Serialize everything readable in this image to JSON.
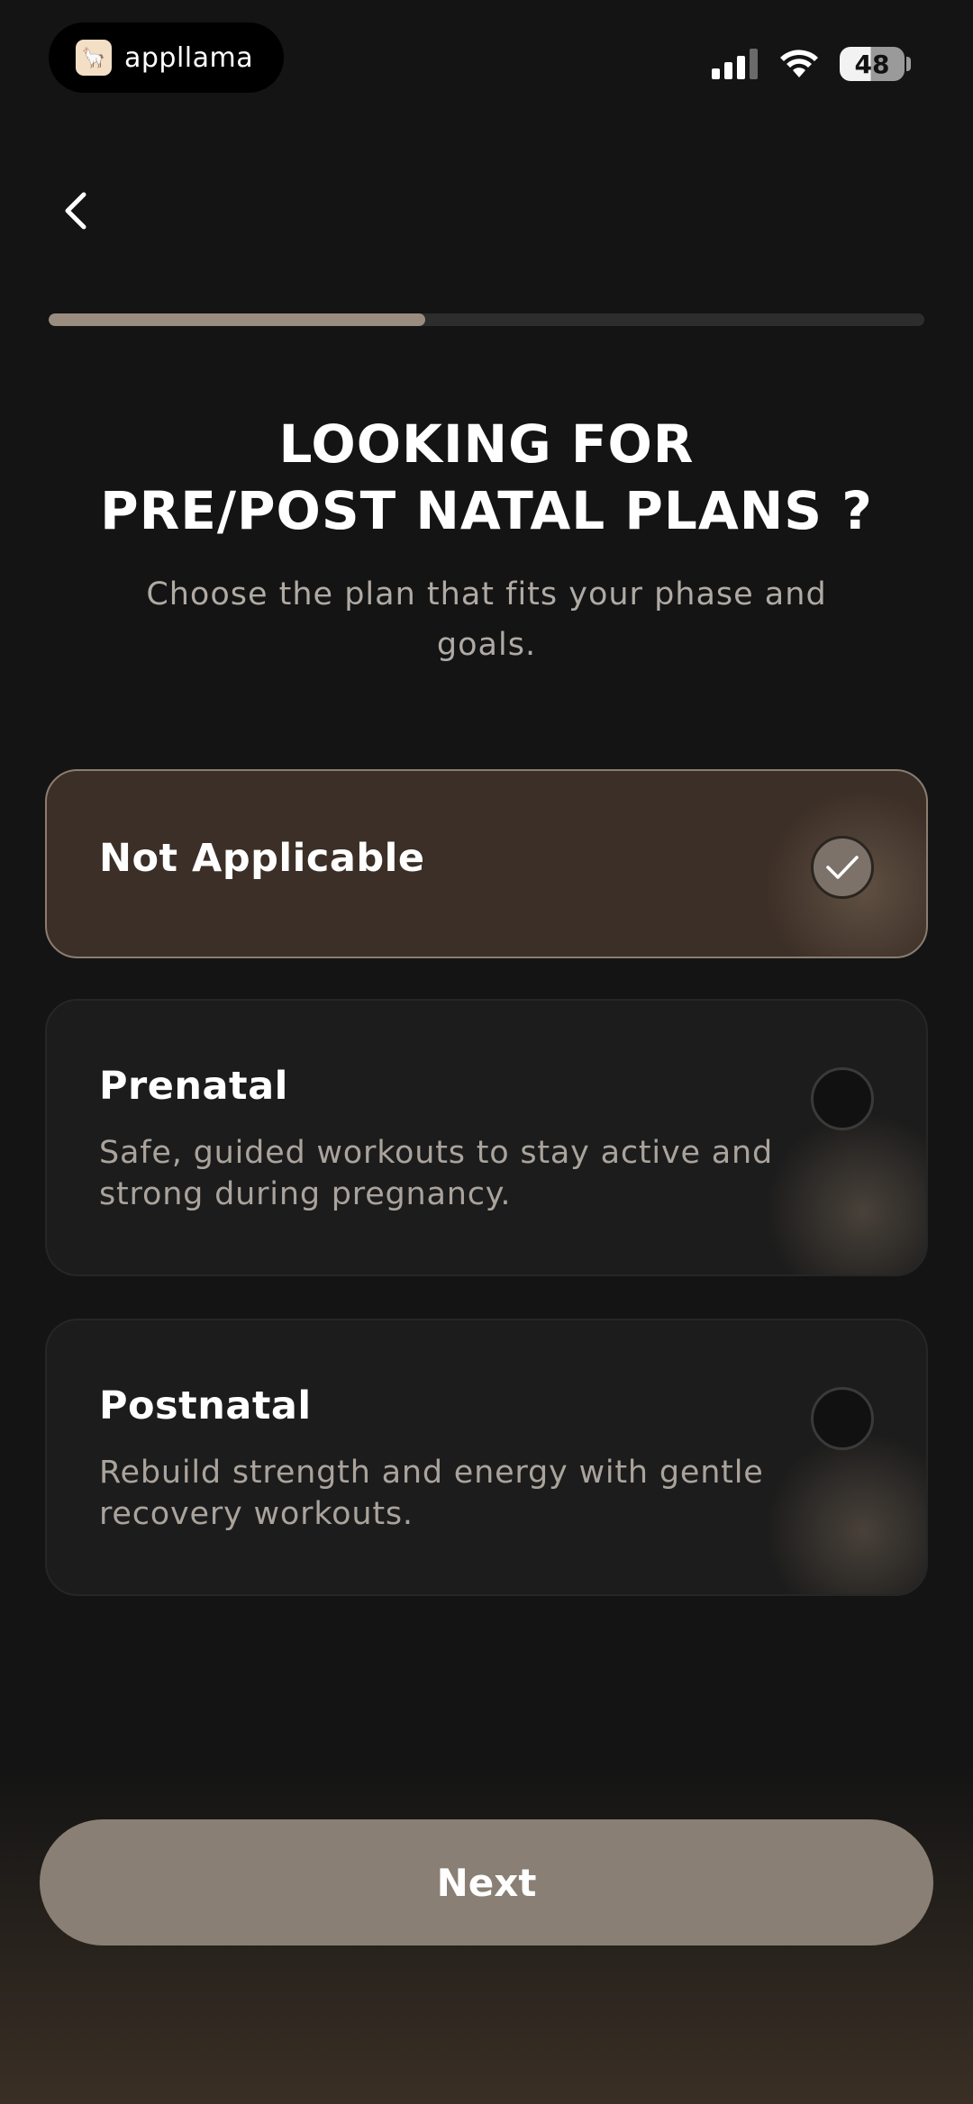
{
  "status_bar": {
    "app_name": "appllama",
    "battery_level": "48"
  },
  "progress": {
    "fraction": 0.43
  },
  "header": {
    "title_line1": "LOOKING FOR",
    "title_line2": "PRE/POST NATAL PLANS ?",
    "subtitle": "Choose the plan that fits your phase and goals."
  },
  "options": [
    {
      "title": "Not Applicable",
      "description": "",
      "selected": true
    },
    {
      "title": "Prenatal",
      "description": "Safe, guided workouts to stay active and strong during pregnancy.",
      "selected": false
    },
    {
      "title": "Postnatal",
      "description": "Rebuild strength and energy with gentle recovery workouts.",
      "selected": false
    }
  ],
  "footer": {
    "next_label": "Next"
  },
  "colors": {
    "background": "#141414",
    "accent": "#8a7f74",
    "selected_card": "#3c2f27",
    "progress_fill": "#9a8c7e"
  }
}
